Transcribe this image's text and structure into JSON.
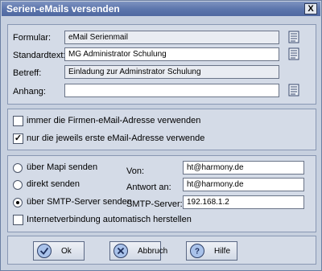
{
  "window": {
    "title": "Serien-eMails versenden",
    "close_glyph": "X"
  },
  "form": {
    "formular_label": "Formular:",
    "formular_value": "eMail Serienmail",
    "standardtext_label": "Standardtext:",
    "standardtext_value": "MG Administrator Schulung",
    "betreff_label": "Betreff:",
    "betreff_value": "Einladung zur Adminstrator Schulung",
    "anhang_label": "Anhang:",
    "anhang_value": ""
  },
  "options": {
    "firmen_label": "immer die Firmen-eMail-Adresse verwenden",
    "firmen_checked": false,
    "erste_label": "nur die jeweils erste eMail-Adresse verwende",
    "erste_checked": true
  },
  "send": {
    "mapi_label": "über Mapi senden",
    "direkt_label": "direkt senden",
    "smtp_label": "über SMTP-Server senden",
    "selected": "smtp",
    "internet_label": "Internetverbindung automatisch herstellen",
    "internet_checked": false,
    "von_label": "Von:",
    "von_value": "ht@harmony.de",
    "antwort_label": "Antwort an:",
    "antwort_value": "ht@harmony.de",
    "smtp_server_label": "SMTP-Server:",
    "smtp_server_value": "192.168.1.2"
  },
  "buttons": {
    "ok": "Ok",
    "abbruch": "Abbruch",
    "hilfe": "Hilfe"
  },
  "icons": {
    "picker": "document-picker-icon",
    "ok": "check-icon",
    "abbruch": "cancel-x-icon",
    "hilfe": "help-icon"
  },
  "colors": {
    "title_bar": "#5d76ad",
    "background": "#c7d0df",
    "panel": "#d4dbe7"
  }
}
